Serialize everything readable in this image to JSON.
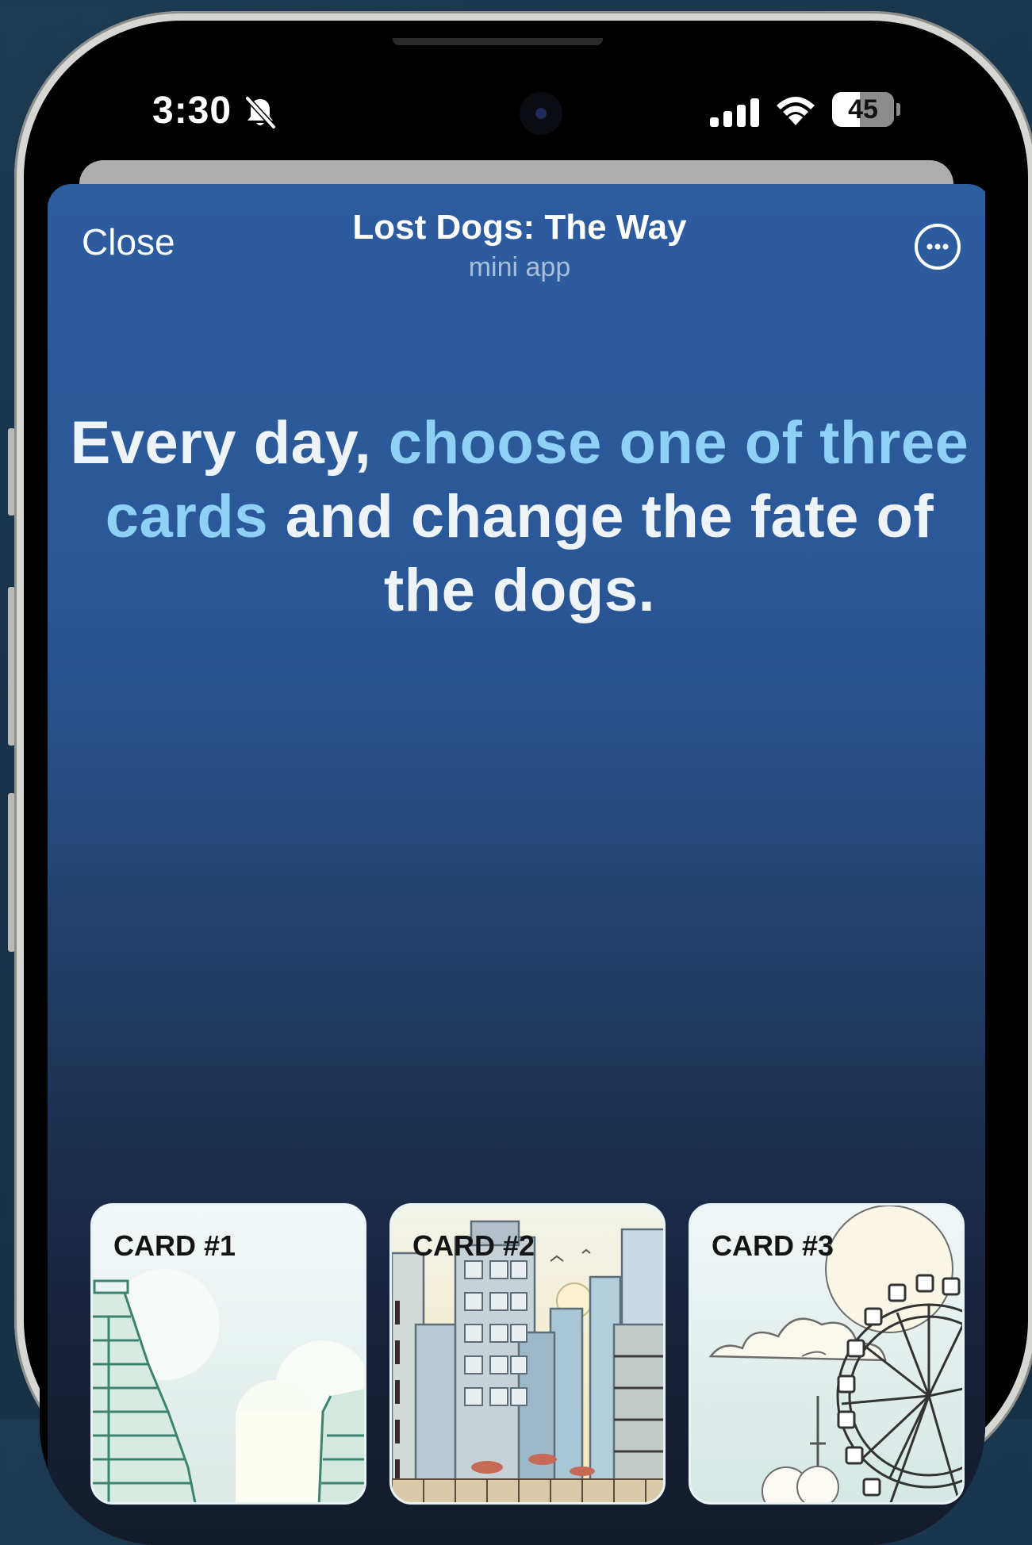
{
  "status_bar": {
    "time": "3:30",
    "battery_level": "45",
    "icons": [
      "bell-slash-icon",
      "signal-icon",
      "wifi-icon",
      "battery-icon"
    ]
  },
  "header": {
    "close_label": "Close",
    "title": "Lost Dogs: The Way",
    "subtitle": "mini app",
    "menu_icon": "more-icon"
  },
  "headline": {
    "part1": "Every day, ",
    "highlight": "choose one of three cards",
    "part2": " and change the fate of the dogs."
  },
  "cards": [
    {
      "label": "CARD #1"
    },
    {
      "label": "CARD #2"
    },
    {
      "label": "CARD #3"
    }
  ],
  "colors": {
    "sheet_top": "#2c5da0",
    "sheet_bottom": "#131a27",
    "highlight": "#8fd0f7",
    "card_bg": "#eef5f8"
  }
}
